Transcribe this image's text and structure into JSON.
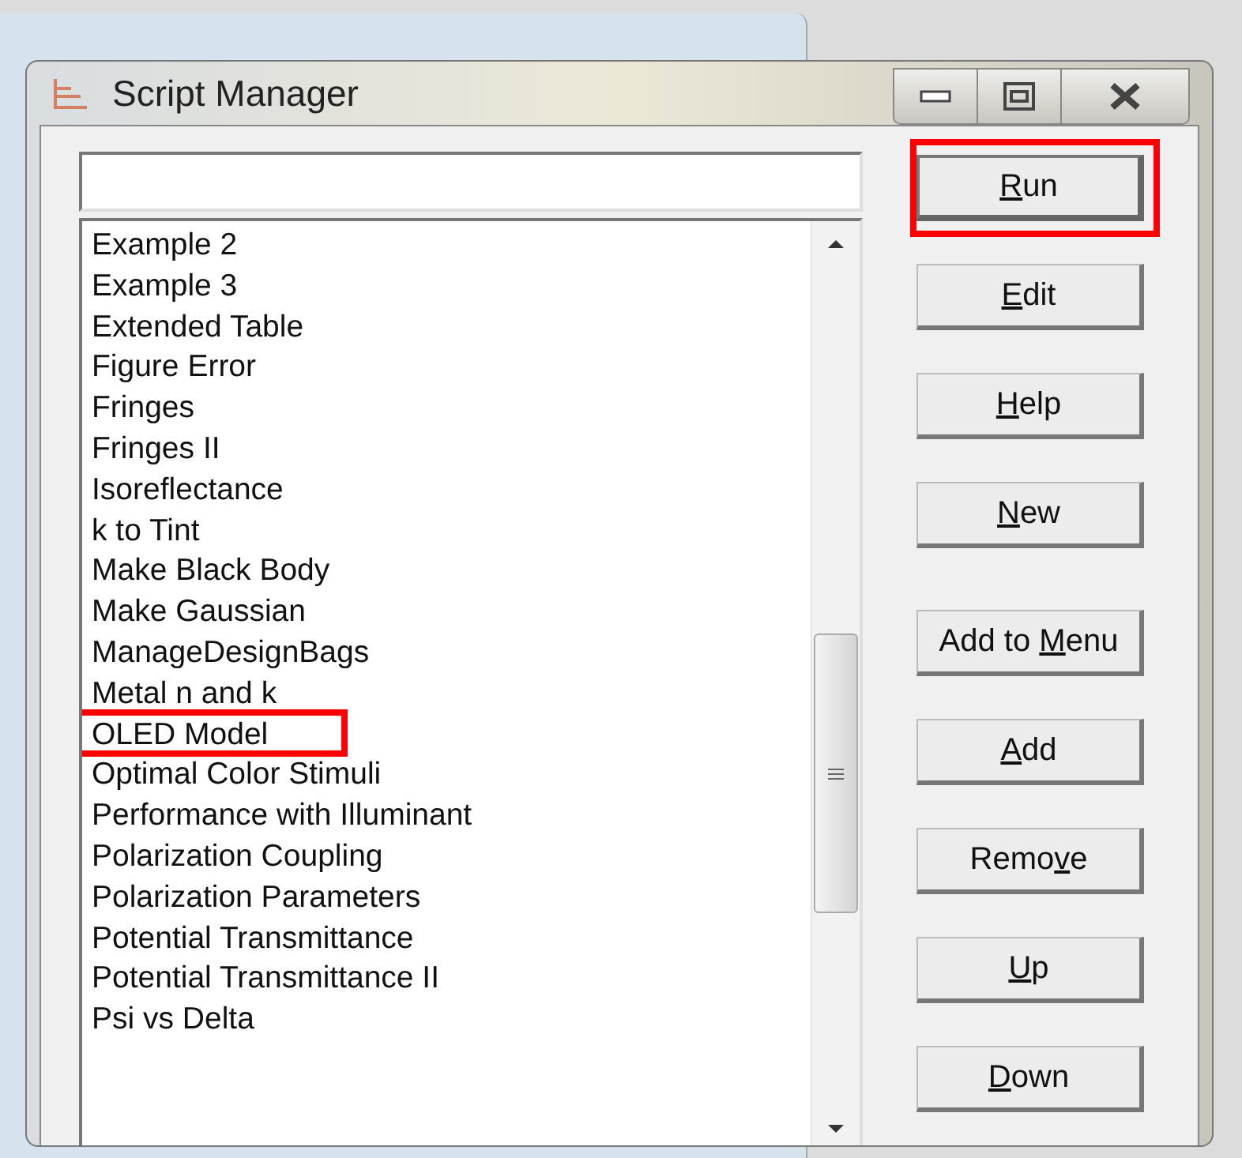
{
  "window": {
    "title": "Script Manager"
  },
  "scripts": [
    {
      "label": "Example 2",
      "selected": false,
      "highlighted": false
    },
    {
      "label": "Example 3",
      "selected": false,
      "highlighted": false
    },
    {
      "label": "Extended Table",
      "selected": false,
      "highlighted": false
    },
    {
      "label": "Figure Error",
      "selected": false,
      "highlighted": false
    },
    {
      "label": "Fringes",
      "selected": false,
      "highlighted": false
    },
    {
      "label": "Fringes II",
      "selected": false,
      "highlighted": false
    },
    {
      "label": "Isoreflectance",
      "selected": false,
      "highlighted": false
    },
    {
      "label": "k to Tint",
      "selected": false,
      "highlighted": false
    },
    {
      "label": "Make Black Body",
      "selected": false,
      "highlighted": false
    },
    {
      "label": "Make Gaussian",
      "selected": false,
      "highlighted": false
    },
    {
      "label": "ManageDesignBags",
      "selected": false,
      "highlighted": false
    },
    {
      "label": "Metal n and k",
      "selected": false,
      "highlighted": false
    },
    {
      "label": "OLED Model",
      "selected": false,
      "highlighted": true
    },
    {
      "label": "Optimal Color Stimuli",
      "selected": false,
      "highlighted": false
    },
    {
      "label": "Performance with Illuminant",
      "selected": false,
      "highlighted": false
    },
    {
      "label": "Polarization Coupling",
      "selected": false,
      "highlighted": false
    },
    {
      "label": "Polarization Parameters",
      "selected": false,
      "highlighted": false
    },
    {
      "label": "Potential Transmittance",
      "selected": false,
      "highlighted": false
    },
    {
      "label": "Potential Transmittance II",
      "selected": false,
      "highlighted": false
    },
    {
      "label": "Psi vs Delta",
      "selected": false,
      "highlighted": false
    }
  ],
  "buttons": [
    {
      "key": "R",
      "post": "un",
      "default": true,
      "highlighted": true
    },
    {
      "key": "E",
      "post": "dit",
      "default": false,
      "highlighted": false
    },
    {
      "key": "H",
      "post": "elp",
      "default": false,
      "highlighted": false
    },
    {
      "key": "N",
      "post": "ew",
      "default": false,
      "highlighted": false
    },
    {
      "pre": "Add to ",
      "key": "M",
      "post": "enu",
      "default": false,
      "highlighted": false
    },
    {
      "key": "A",
      "post": "dd",
      "default": false,
      "highlighted": false
    },
    {
      "pre": "Remo",
      "key": "v",
      "post": "e",
      "default": false,
      "highlighted": false
    },
    {
      "key": "U",
      "post": "p",
      "default": false,
      "highlighted": false
    },
    {
      "key": "D",
      "post": "own",
      "default": false,
      "highlighted": false
    }
  ]
}
